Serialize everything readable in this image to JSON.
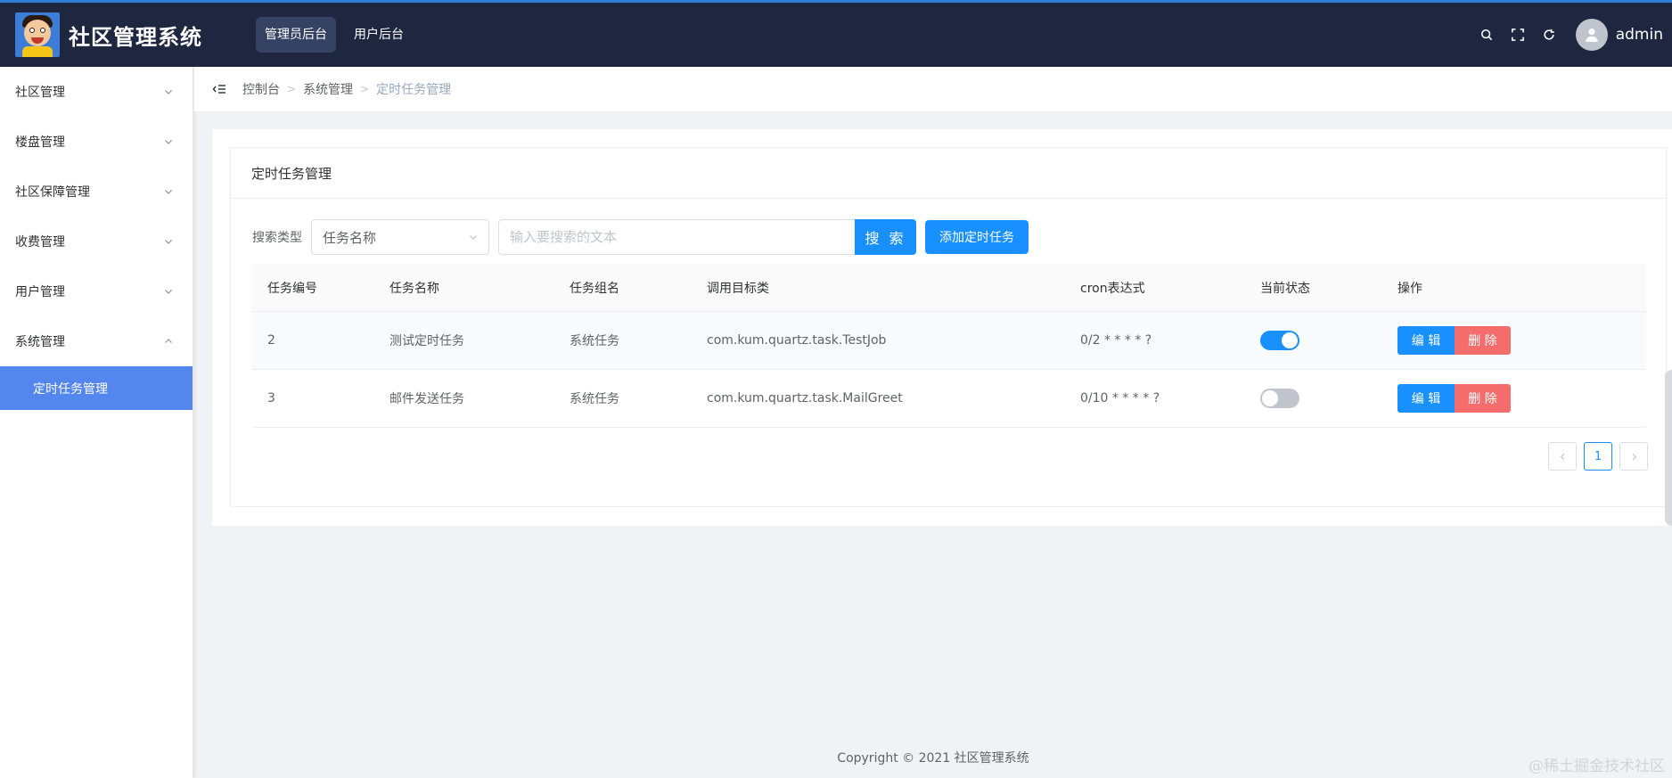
{
  "app": {
    "title": "社区管理系统",
    "username": "admin"
  },
  "top_nav": [
    {
      "label": "管理员后台",
      "active": true
    },
    {
      "label": "用户后台",
      "active": false
    }
  ],
  "header_icons": [
    "search-icon",
    "fullscreen-icon",
    "refresh-icon"
  ],
  "sidebar": {
    "items": [
      {
        "label": "社区管理",
        "expanded": false
      },
      {
        "label": "楼盘管理",
        "expanded": false
      },
      {
        "label": "社区保障管理",
        "expanded": false
      },
      {
        "label": "收费管理",
        "expanded": false
      },
      {
        "label": "用户管理",
        "expanded": false
      },
      {
        "label": "系统管理",
        "expanded": true
      }
    ],
    "active_sub": "定时任务管理"
  },
  "breadcrumb": [
    "控制台",
    "系统管理",
    "定时任务管理"
  ],
  "card": {
    "title": "定时任务管理"
  },
  "search": {
    "label": "搜索类型",
    "type_value": "任务名称",
    "placeholder": "输入要搜索的文本",
    "button": "搜 索",
    "add_button": "添加定时任务"
  },
  "table": {
    "columns": [
      "任务编号",
      "任务名称",
      "任务组名",
      "调用目标类",
      "cron表达式",
      "当前状态",
      "操作"
    ],
    "rows": [
      {
        "id": "2",
        "name": "测试定时任务",
        "group": "系统任务",
        "target": "com.kum.quartz.task.TestJob",
        "cron": "0/2 * * * * ?",
        "enabled": true
      },
      {
        "id": "3",
        "name": "邮件发送任务",
        "group": "系统任务",
        "target": "com.kum.quartz.task.MailGreet",
        "cron": "0/10 * * * * ?",
        "enabled": false
      }
    ],
    "edit_label": "编 辑",
    "delete_label": "删 除"
  },
  "pagination": {
    "current": "1"
  },
  "footer": "Copyright © 2021 社区管理系统",
  "watermark": "@稀土掘金技术社区",
  "colors": {
    "header_bg": "#1f2740",
    "primary": "#1890ff",
    "danger": "#f56c6c",
    "sidebar_active": "#5487ee"
  }
}
